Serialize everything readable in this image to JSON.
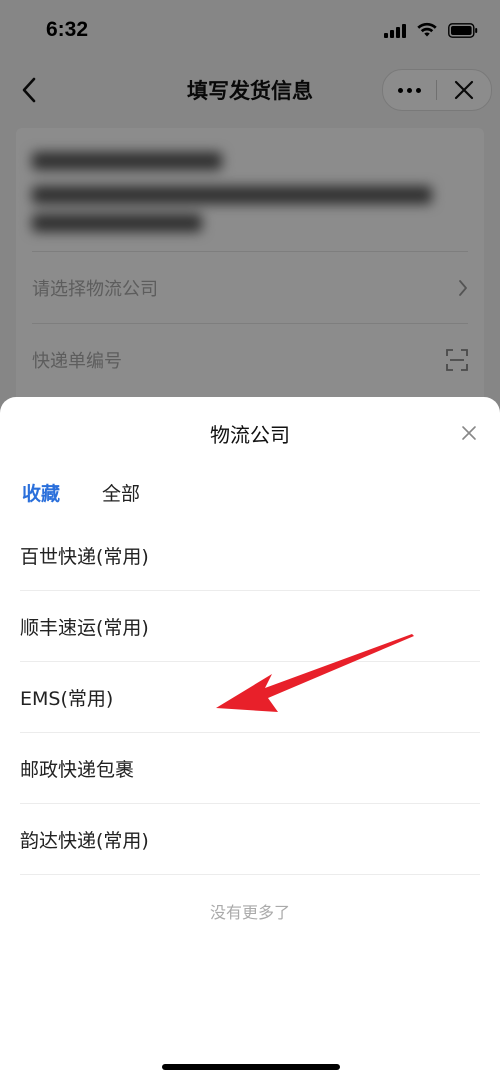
{
  "status_bar": {
    "time": "6:32"
  },
  "nav": {
    "title": "填写发货信息"
  },
  "form": {
    "carrier_placeholder": "请选择物流公司",
    "tracking_placeholder": "快递单编号"
  },
  "sheet": {
    "title": "物流公司",
    "tabs": [
      {
        "label": "收藏",
        "active": true
      },
      {
        "label": "全部",
        "active": false
      }
    ],
    "items": [
      {
        "label": "百世快递(常用)"
      },
      {
        "label": "顺丰速运(常用)"
      },
      {
        "label": "EMS(常用)"
      },
      {
        "label": "邮政快递包裹"
      },
      {
        "label": "韵达快递(常用)"
      }
    ],
    "no_more_text": "没有更多了"
  },
  "colors": {
    "accent": "#2a6fdb",
    "annotation_arrow": "#e8202a",
    "overlay": "rgba(0,0,0,0.45)"
  }
}
